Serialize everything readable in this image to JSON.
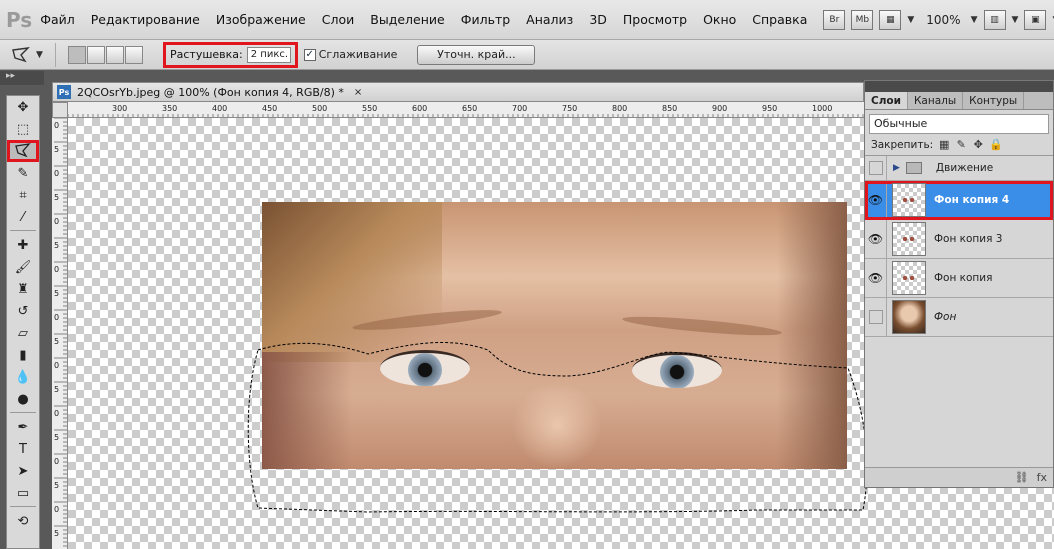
{
  "app": {
    "logo": "Ps"
  },
  "menu": [
    "Файл",
    "Редактирование",
    "Изображение",
    "Слои",
    "Выделение",
    "Фильтр",
    "Анализ",
    "3D",
    "Просмотр",
    "Окно",
    "Справка"
  ],
  "menubar_right": {
    "br": "Br",
    "mb": "Mb",
    "zoom": "100%"
  },
  "options": {
    "feather_label": "Растушевка:",
    "feather_value": "2 пикс.",
    "antialias_label": "Сглаживание",
    "antialias_checked": true,
    "refine_button": "Уточн. край..."
  },
  "document": {
    "title": "2QCOsrYb.jpeg @ 100% (Фон копия 4, RGB/8) *",
    "close": "×",
    "ruler_top": [
      "300",
      "350",
      "400",
      "450",
      "500",
      "550",
      "600",
      "650",
      "700",
      "750",
      "800",
      "850",
      "900",
      "950",
      "1000"
    ],
    "ruler_left": [
      "0",
      "5",
      "0",
      "5",
      "0",
      "5",
      "0",
      "5",
      "0",
      "5",
      "0",
      "5",
      "0",
      "5",
      "0",
      "5",
      "0",
      "5"
    ]
  },
  "layers_panel": {
    "tabs": [
      "Слои",
      "Каналы",
      "Контуры"
    ],
    "blend_mode": "Обычные",
    "lock_label": "Закрепить:",
    "layers": [
      {
        "name": "Движение",
        "type": "group",
        "visible": false
      },
      {
        "name": "Фон копия 4",
        "type": "layer",
        "visible": true,
        "selected": true
      },
      {
        "name": "Фон копия 3",
        "type": "layer",
        "visible": true
      },
      {
        "name": "Фон копия",
        "type": "layer",
        "visible": true
      },
      {
        "name": "Фон",
        "type": "background",
        "visible": false
      }
    ],
    "bottom_icons": [
      "link-icon",
      "fx-icon"
    ],
    "fx_label": "fx"
  },
  "colors": {
    "highlight": "#e0151d",
    "selected_layer": "#3a8ee8"
  }
}
